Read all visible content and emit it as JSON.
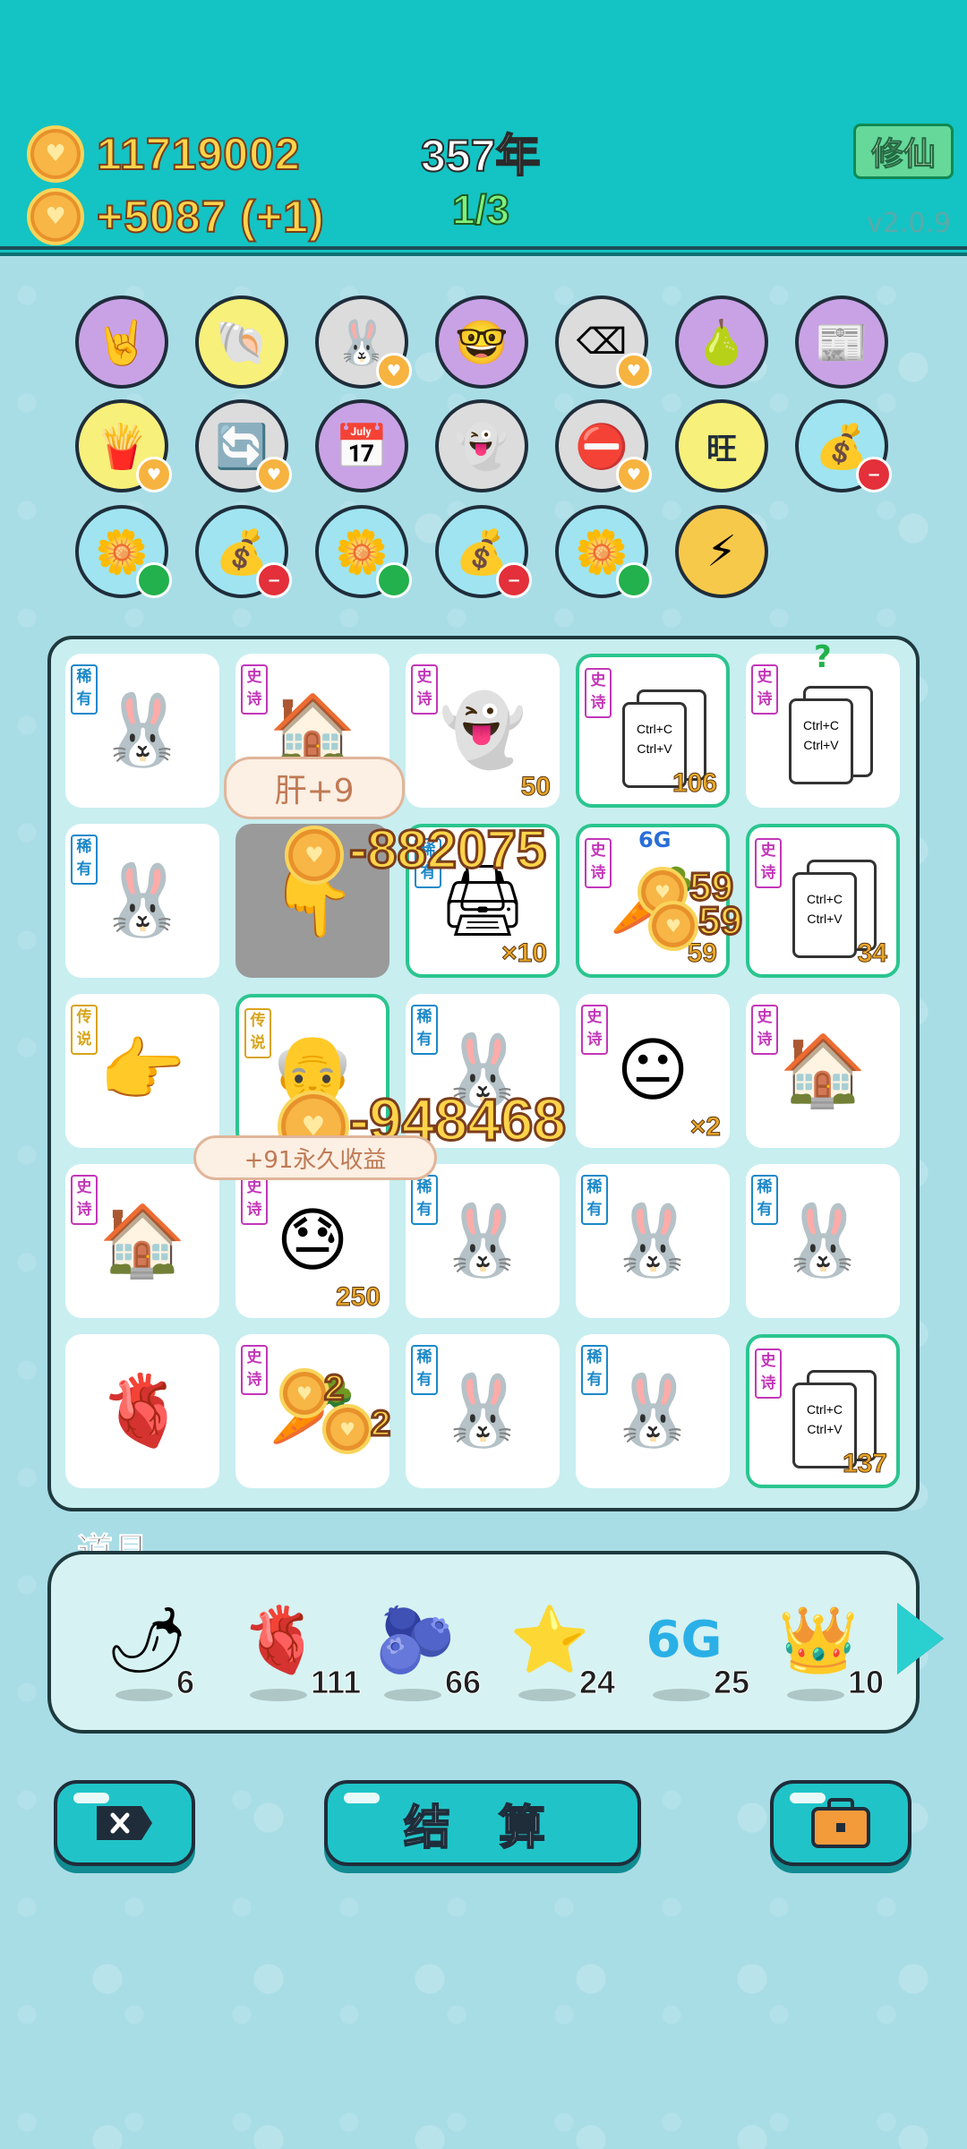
{
  "header": {
    "gold_total": "11719002",
    "gold_rate": "+5087 (+1)",
    "year": "357年",
    "round": "1/3",
    "xiuxian_button": "修仙",
    "version": "v2.0.9"
  },
  "items": [
    {
      "row": 1,
      "col": 1,
      "icon": "rock-hand-icon",
      "glyph": "🤘",
      "bg": "#c9a2e6"
    },
    {
      "row": 1,
      "col": 2,
      "icon": "shell-icon",
      "glyph": "🐚",
      "bg": "#f7f07a"
    },
    {
      "row": 1,
      "col": 3,
      "icon": "bunny-icon",
      "glyph": "🐰",
      "bg": "#dcdcdc",
      "badge": "heart"
    },
    {
      "row": 1,
      "col": 4,
      "icon": "math-nerd-icon",
      "glyph": "🤓",
      "bg": "#c9a2e6"
    },
    {
      "row": 1,
      "col": 5,
      "icon": "delete-key-icon",
      "glyph": "⌫",
      "bg": "#dcdcdc",
      "badge": "heart"
    },
    {
      "row": 1,
      "col": 6,
      "icon": "pomelo-icon",
      "glyph": "🍐",
      "bg": "#c9a2e6"
    },
    {
      "row": 1,
      "col": 7,
      "icon": "time-magazine-icon",
      "glyph": "📰",
      "bg": "#c9a2e6"
    },
    {
      "row": 2,
      "col": 1,
      "icon": "fries-icon",
      "glyph": "🍟",
      "bg": "#f7f07a",
      "badge": "heart"
    },
    {
      "row": 2,
      "col": 2,
      "icon": "recycle-icon",
      "glyph": "🔄",
      "bg": "#dcdcdc",
      "badge": "heart"
    },
    {
      "row": 2,
      "col": 3,
      "icon": "calendar-icon",
      "glyph": "📅",
      "bg": "#c9a2e6"
    },
    {
      "row": 2,
      "col": 4,
      "icon": "ghost-icon",
      "glyph": "👻",
      "bg": "#dcdcdc"
    },
    {
      "row": 2,
      "col": 5,
      "icon": "minus-sign-icon",
      "glyph": "⛔",
      "bg": "#dcdcdc",
      "badge": "heart"
    },
    {
      "row": 2,
      "col": 6,
      "icon": "wang-chars-icon",
      "glyph": "旺",
      "bg": "#f7f07a"
    },
    {
      "row": 2,
      "col": 7,
      "icon": "money-bag-icon",
      "glyph": "💰",
      "bg": "#9fe4f0",
      "badge": "red"
    },
    {
      "row": 3,
      "col": 1,
      "icon": "flower-pot-icon",
      "glyph": "🌼",
      "bg": "#9fe4f0",
      "badge": "green"
    },
    {
      "row": 3,
      "col": 2,
      "icon": "money-bag-icon",
      "glyph": "💰",
      "bg": "#9fe4f0",
      "badge": "red"
    },
    {
      "row": 3,
      "col": 3,
      "icon": "flower-pot-icon",
      "glyph": "🌼",
      "bg": "#9fe4f0",
      "badge": "green"
    },
    {
      "row": 3,
      "col": 4,
      "icon": "money-bag-icon",
      "glyph": "💰",
      "bg": "#9fe4f0",
      "badge": "red"
    },
    {
      "row": 3,
      "col": 5,
      "icon": "flower-pot-icon",
      "glyph": "🌼",
      "bg": "#9fe4f0",
      "badge": "green"
    },
    {
      "row": 3,
      "col": 6,
      "icon": "lightning-icon",
      "glyph": "⚡",
      "bg": "#f7c94a"
    }
  ],
  "board": [
    {
      "r": 0,
      "c": 0,
      "tag": "稀有",
      "tier": "rare",
      "icon": "bunny-icon",
      "glyph": "🐰"
    },
    {
      "r": 0,
      "c": 1,
      "tag": "史诗",
      "tier": "epic",
      "icon": "bunny-house-icon",
      "glyph": "🏠"
    },
    {
      "r": 0,
      "c": 2,
      "tag": "史诗",
      "tier": "epic",
      "icon": "ghost-dead-icon",
      "glyph": "👻",
      "num": "50"
    },
    {
      "r": 0,
      "c": 3,
      "tag": "史诗",
      "tier": "epic",
      "icon": "copy-paste-icon",
      "copy": true,
      "num": "106",
      "hl": true
    },
    {
      "r": 0,
      "c": 4,
      "tag": "史诗",
      "tier": "epic",
      "icon": "copy-paste-icon",
      "copy": true,
      "mark": "?"
    },
    {
      "r": 1,
      "c": 0,
      "tag": "稀有",
      "tier": "rare",
      "icon": "bunny-icon",
      "glyph": "🐰"
    },
    {
      "r": 1,
      "c": 1,
      "grey": true,
      "icon": "pointing-hand-icon",
      "glyph": "👇"
    },
    {
      "r": 1,
      "c": 2,
      "tag": "稀有",
      "tier": "rare",
      "icon": "printer-icon",
      "glyph": "🖨",
      "num": "×10",
      "hl": true
    },
    {
      "r": 1,
      "c": 3,
      "tag": "史诗",
      "tier": "epic",
      "icon": "carrot-icon",
      "glyph": "🥕",
      "num": "59",
      "hl": true,
      "label6g": "6G"
    },
    {
      "r": 1,
      "c": 4,
      "tag": "史诗",
      "tier": "epic",
      "icon": "copy-paste-icon",
      "copy": true,
      "num": "34",
      "hl": true
    },
    {
      "r": 2,
      "c": 0,
      "tag": "传说",
      "tier": "legend",
      "icon": "pointing-hand-icon",
      "glyph": "👉"
    },
    {
      "r": 2,
      "c": 1,
      "tag": "传说",
      "tier": "legend",
      "icon": "king-icon",
      "glyph": "👴",
      "hl": true
    },
    {
      "r": 2,
      "c": 2,
      "tag": "稀有",
      "tier": "rare",
      "icon": "bunny-icon",
      "glyph": "🐰"
    },
    {
      "r": 2,
      "c": 3,
      "tag": "史诗",
      "tier": "epic",
      "icon": "face-icon",
      "glyph": "😐",
      "num": "×2"
    },
    {
      "r": 2,
      "c": 4,
      "tag": "史诗",
      "tier": "epic",
      "icon": "bunny-house-icon",
      "glyph": "🏠"
    },
    {
      "r": 3,
      "c": 0,
      "tag": "史诗",
      "tier": "epic",
      "icon": "bunny-house-icon",
      "glyph": "🏠"
    },
    {
      "r": 3,
      "c": 1,
      "tag": "史诗",
      "tier": "epic",
      "icon": "face-sweat-icon",
      "glyph": "😓",
      "num": "250"
    },
    {
      "r": 3,
      "c": 2,
      "tag": "稀有",
      "tier": "rare",
      "icon": "bunny-icon",
      "glyph": "🐰"
    },
    {
      "r": 3,
      "c": 3,
      "tag": "稀有",
      "tier": "rare",
      "icon": "bunny-icon",
      "glyph": "🐰"
    },
    {
      "r": 3,
      "c": 4,
      "tag": "稀有",
      "tier": "rare",
      "icon": "bunny-icon",
      "glyph": "🐰"
    },
    {
      "r": 4,
      "c": 0,
      "icon": "liver-coin-icon",
      "glyph": "🫀"
    },
    {
      "r": 4,
      "c": 1,
      "tag": "史诗",
      "tier": "epic",
      "icon": "carrot-icon",
      "glyph": "🥕"
    },
    {
      "r": 4,
      "c": 2,
      "tag": "稀有",
      "tier": "rare",
      "icon": "bunny-icon",
      "glyph": "🐰"
    },
    {
      "r": 4,
      "c": 3,
      "tag": "稀有",
      "tier": "rare",
      "icon": "bunny-icon",
      "glyph": "🐰"
    },
    {
      "r": 4,
      "c": 4,
      "tag": "史诗",
      "tier": "epic",
      "icon": "copy-paste-icon",
      "copy": true,
      "num": "137",
      "hl": true
    }
  ],
  "copy_card_text": "Ctrl+C\nCtrl+V",
  "effects": {
    "liver_bubble": "肝+9",
    "neg1": "-882075",
    "neg2": "-948468",
    "income_bubble": "+91永久收益",
    "carrot_gain_a": "59",
    "carrot_gain_b": "59",
    "carrot2_gain_a": "2",
    "carrot2_gain_b": "2"
  },
  "tools": {
    "label": "道具",
    "items": [
      {
        "icon": "chili-pepper-icon",
        "glyph": "🌶",
        "count": "6"
      },
      {
        "icon": "liver-icon",
        "glyph": "🫀",
        "count": "111"
      },
      {
        "icon": "blueberry-icon",
        "glyph": "🫐",
        "count": "66"
      },
      {
        "icon": "star-icon",
        "glyph": "⭐",
        "count": "24"
      },
      {
        "icon": "6g-icon",
        "glyph": "6G",
        "count": "25"
      },
      {
        "icon": "crown-icon",
        "glyph": "👑",
        "count": "10"
      }
    ]
  },
  "buttons": {
    "settle": "结 算"
  },
  "colors": {
    "header": "#14c3c3",
    "background": "#a9dde6",
    "gold_text": "#ffd44a",
    "highlight_border": "#2bc58e"
  }
}
